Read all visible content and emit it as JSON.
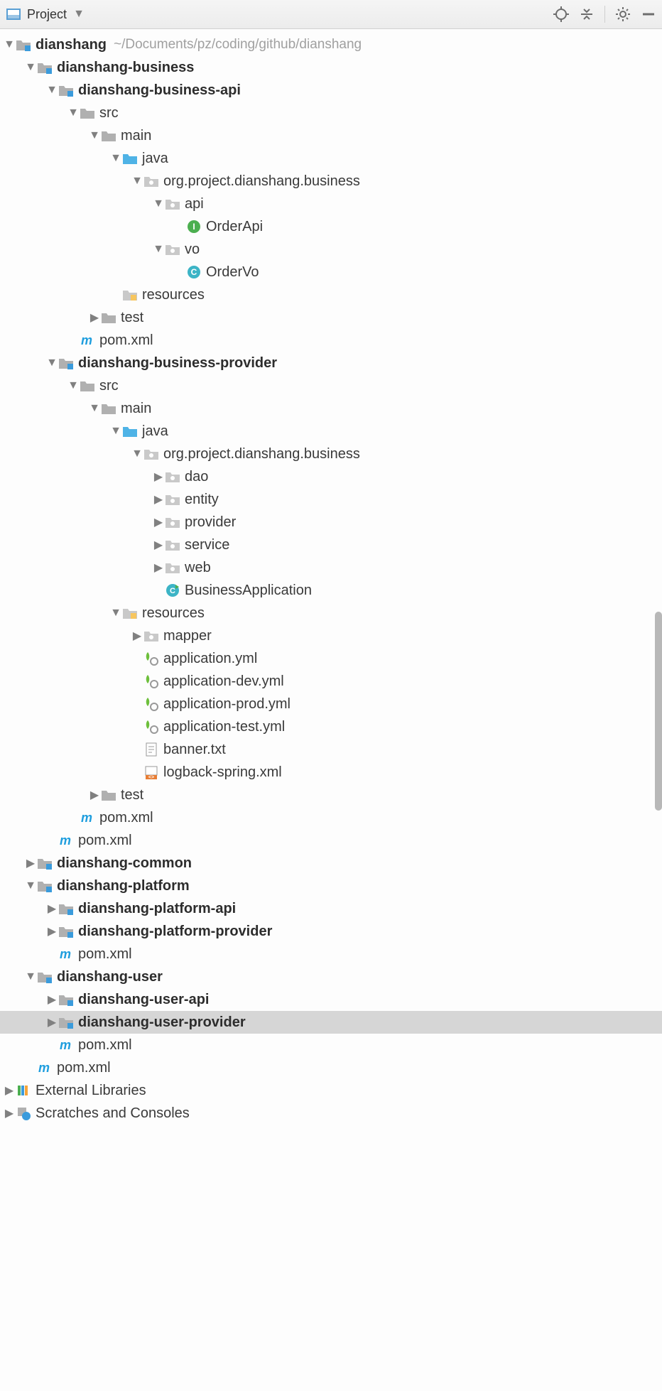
{
  "toolbar": {
    "label": "Project"
  },
  "root": {
    "name": "dianshang",
    "path": "~/Documents/pz/coding/github/dianshang"
  },
  "business": {
    "name": "dianshang-business",
    "api": "dianshang-business-api",
    "provider": "dianshang-business-provider"
  },
  "src": "src",
  "main": "main",
  "test": "test",
  "java": "java",
  "resources": "resources",
  "pkg_business": "org.project.dianshang.business",
  "api_pkg": "api",
  "vo_pkg": "vo",
  "OrderApi": "OrderApi",
  "OrderVo": "OrderVo",
  "dao": "dao",
  "entity": "entity",
  "provider": "provider",
  "service": "service",
  "web": "web",
  "BusinessApplication": "BusinessApplication",
  "mapper": "mapper",
  "app_yml": "application.yml",
  "app_dev_yml": "application-dev.yml",
  "app_prod_yml": "application-prod.yml",
  "app_test_yml": "application-test.yml",
  "banner_txt": "banner.txt",
  "logback_xml": "logback-spring.xml",
  "pom": "pom.xml",
  "common": "dianshang-common",
  "platform": {
    "name": "dianshang-platform",
    "api": "dianshang-platform-api",
    "provider": "dianshang-platform-provider"
  },
  "user": {
    "name": "dianshang-user",
    "api": "dianshang-user-api",
    "provider": "dianshang-user-provider"
  },
  "ext_lib": "External Libraries",
  "scratches": "Scratches and Consoles"
}
